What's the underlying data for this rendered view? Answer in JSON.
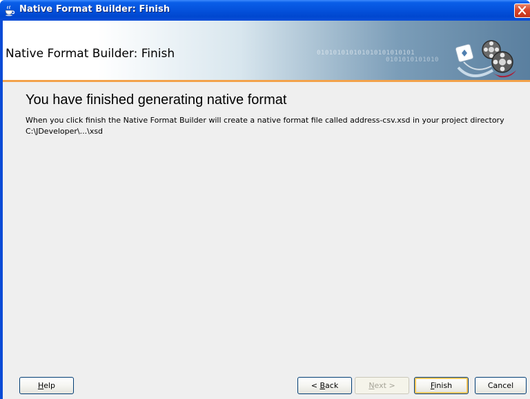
{
  "window": {
    "title": "Native Format Builder: Finish",
    "icon": "java-cup-icon"
  },
  "banner": {
    "title": "Native Format Builder: Finish",
    "binary_line_1": "010101010101010101010101",
    "binary_line_2": "0101010101010",
    "graphic": "film-reel-icon"
  },
  "content": {
    "heading": "You have finished generating native format",
    "message": "When you click finish the Native Format Builder will create a native format file called address-csv.xsd in your project directory C:\\JDeveloper\\...\\xsd"
  },
  "buttons": {
    "help": {
      "label": "Help",
      "mnemonic": "H",
      "rest": "elp"
    },
    "back": {
      "label": "< Back",
      "prefix": "< ",
      "mnemonic": "B",
      "rest": "ack"
    },
    "next": {
      "label": "Next >",
      "mnemonic": "N",
      "rest": "ext >",
      "enabled": false
    },
    "finish": {
      "label": "Finish",
      "mnemonic": "F",
      "rest": "inish"
    },
    "cancel": {
      "label": "Cancel"
    }
  },
  "colors": {
    "title_bar": "#0553dd",
    "accent_rule": "#f3a24a",
    "dialog_background": "#efefef"
  }
}
